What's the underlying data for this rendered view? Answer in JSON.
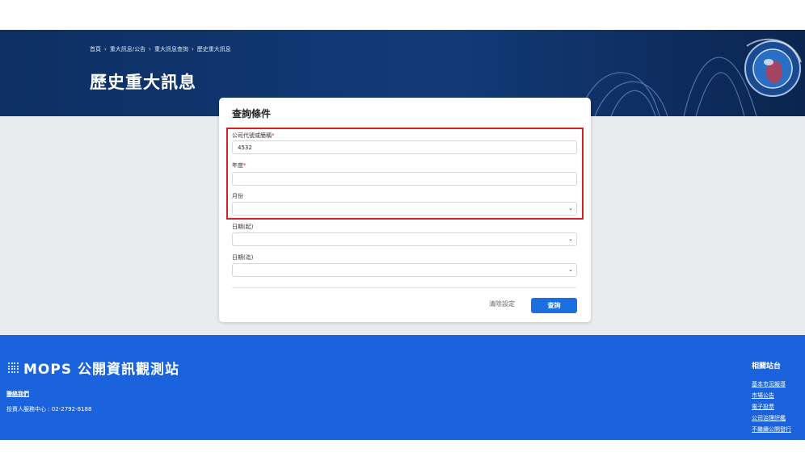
{
  "breadcrumb": {
    "items": [
      "首頁",
      "重大訊息/公告",
      "重大訊息查詢",
      "歷史重大訊息"
    ],
    "separator": "›"
  },
  "page_title": "歷史重大訊息",
  "form": {
    "title": "查詢條件",
    "company_label": "公司代號或簡稱",
    "company_value": "4532",
    "year_label": "年度",
    "year_value": "",
    "month_label": "月份",
    "month_value": "",
    "date_start_label": "日期(起)",
    "date_start_value": "",
    "date_end_label": "日期(迄)",
    "date_end_value": "",
    "required_mark": "*",
    "clear_label": "清除設定",
    "search_label": "查詢"
  },
  "footer": {
    "logo_text": "MOPS 公開資訊觀測站",
    "contact_label": "聯絡我們",
    "hotline": "投資人服務中心 : 02-2792-8188",
    "related_title": "相關站台",
    "related_links": [
      "基本市況報導",
      "市場公告",
      "電子投票",
      "公司治理評鑑",
      "不繼續公開發行"
    ]
  },
  "colors": {
    "hero": "#123b78",
    "accent": "#1b6fe0",
    "footer": "#1a63dc",
    "highlight": "#d42028",
    "required": "#d81d2c"
  }
}
